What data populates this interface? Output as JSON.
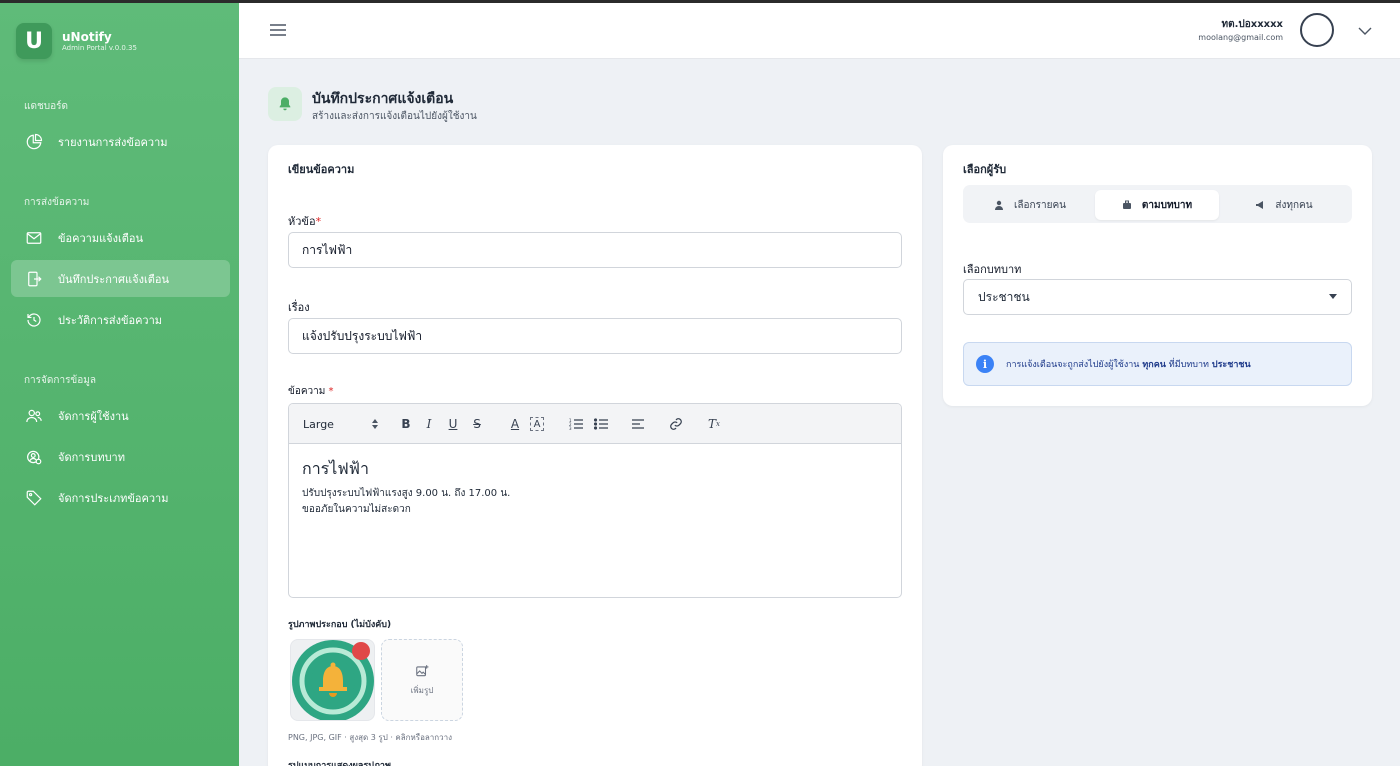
{
  "app": {
    "name": "uNotify",
    "version": "Admin Portal v.0.0.35",
    "logo_letter": "U"
  },
  "sidebar": {
    "sections": [
      {
        "label": "แดชบอร์ด"
      },
      {
        "label": "การส่งข้อความ"
      },
      {
        "label": "การจัดการข้อมูล"
      }
    ],
    "items": [
      {
        "label": "รายงานการส่งข้อความ",
        "icon": "chart-pie-icon"
      },
      {
        "label": "ข้อความแจ้งเตือน",
        "icon": "mail-icon"
      },
      {
        "label": "บันทึกประกาศแจ้งเตือน",
        "icon": "announcement-icon",
        "active": true
      },
      {
        "label": "ประวัติการส่งข้อความ",
        "icon": "history-icon"
      },
      {
        "label": "จัดการผู้ใช้งาน",
        "icon": "users-icon"
      },
      {
        "label": "จัดการบทบาท",
        "icon": "role-icon"
      },
      {
        "label": "จัดการประเภทข้อความ",
        "icon": "tag-icon"
      }
    ]
  },
  "header": {
    "user_name": "ทต.ปอxxxxx",
    "user_email": "moolang@gmail.com"
  },
  "page": {
    "title": "บันทึกประกาศแจ้งเตือน",
    "subtitle": "สร้างและส่งการแจ้งเตือนไปยังผู้ใช้งาน"
  },
  "compose": {
    "card_title": "เขียนข้อความ",
    "subject_label": "หัวข้อ",
    "subject_value": "การไฟฟ้า",
    "topic_label": "เรื่อง",
    "topic_value": "แจ้งปรับปรุงระบบไฟฟ้า",
    "message_label": "ข้อความ",
    "toolbar": {
      "size": "Large"
    },
    "editor": {
      "heading": "การไฟฟ้า",
      "line1": "ปรับปรุงระบบไฟฟ้าแรงสูง 9.00 น. ถึง 17.00 น.",
      "line2": "ขออภัยในความไม่สะดวก"
    },
    "image_label": "รูปภาพประกอบ (ไม่บังคับ)",
    "add_image_label": "เพิ่มรูป",
    "image_hint": "PNG, JPG, GIF · สูงสุด 3 รูป · คลิกหรือลากวาง",
    "cut_label": "รูปแบบการแสดงผลรูปภาพ"
  },
  "recipients": {
    "card_title": "เลือกผู้รับ",
    "tabs": [
      {
        "label": "เลือกรายคน",
        "icon": "person-icon"
      },
      {
        "label": "ตามบทบาท",
        "icon": "briefcase-icon",
        "active": true
      },
      {
        "label": "ส่งทุกคน",
        "icon": "megaphone-icon"
      }
    ],
    "role_label": "เลือกบทบาท",
    "role_value": "ประชาชน",
    "info_prefix": "การแจ้งเตือนจะถูกส่งไปยังผู้ใช้งาน",
    "info_all": "ทุกคน",
    "info_mid": "ที่มีบทบาท",
    "info_role": "ประชาชน"
  },
  "colors": {
    "sidebar": "#4cae66",
    "accent": "#3f9a5b",
    "info_bg": "#eaf1fb",
    "danger": "#e04848"
  }
}
